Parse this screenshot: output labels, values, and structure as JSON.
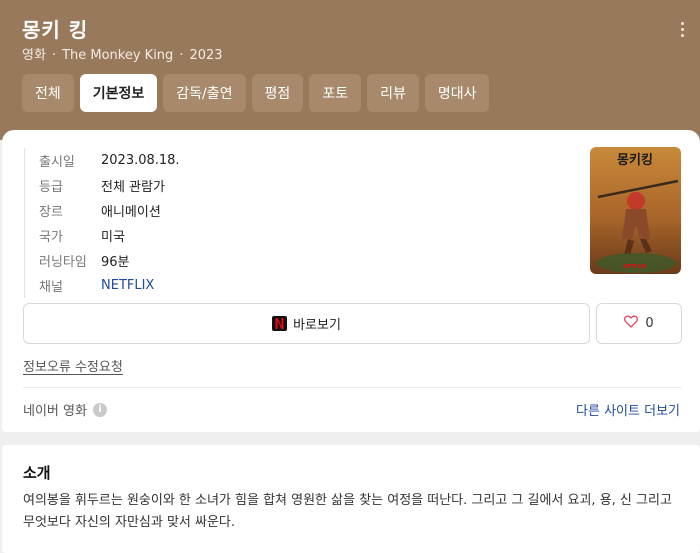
{
  "header": {
    "title": "몽키 킹",
    "meta": [
      "영화",
      "The Monkey King",
      "2023"
    ],
    "separator": "·",
    "more_icon": "more-vertical-icon"
  },
  "tabs": [
    {
      "label": "전체",
      "active": false
    },
    {
      "label": "기본정보",
      "active": true
    },
    {
      "label": "감독/출연",
      "active": false
    },
    {
      "label": "평점",
      "active": false
    },
    {
      "label": "포토",
      "active": false
    },
    {
      "label": "리뷰",
      "active": false
    },
    {
      "label": "명대사",
      "active": false
    }
  ],
  "info": [
    {
      "key": "출시일",
      "value": "2023.08.18."
    },
    {
      "key": "등급",
      "value": "전체 관람가"
    },
    {
      "key": "장르",
      "value": "애니메이션"
    },
    {
      "key": "국가",
      "value": "미국"
    },
    {
      "key": "러닝타임",
      "value": "96분"
    },
    {
      "key": "채널",
      "value": "NETFLIX"
    }
  ],
  "poster": {
    "title_text": "몽키킹",
    "badge": "NETFLIX"
  },
  "actions": {
    "watch_label": "바로보기",
    "watch_icon": "netflix-icon",
    "like_count": "0",
    "like_icon": "heart-icon"
  },
  "report_link": "정보오류 수정요청",
  "source": {
    "label": "네이버 영화",
    "info_icon": "i",
    "other_sites": "다른 사이트 더보기"
  },
  "intro": {
    "heading": "소개",
    "text": "여의봉을 휘두르는 원숭이와 한 소녀가 힘을 합쳐 영원한 삶을 찾는 여정을 떠난다. 그리고 그 길에서 요괴, 용, 신 그리고 무엇보다 자신의 자만심과 맞서 싸운다."
  },
  "colors": {
    "header_bg": "#98795c",
    "tab_bg": "#a9896c",
    "link": "#1f4aa0",
    "netflix_red": "#e50914",
    "heart": "#e0465c"
  }
}
